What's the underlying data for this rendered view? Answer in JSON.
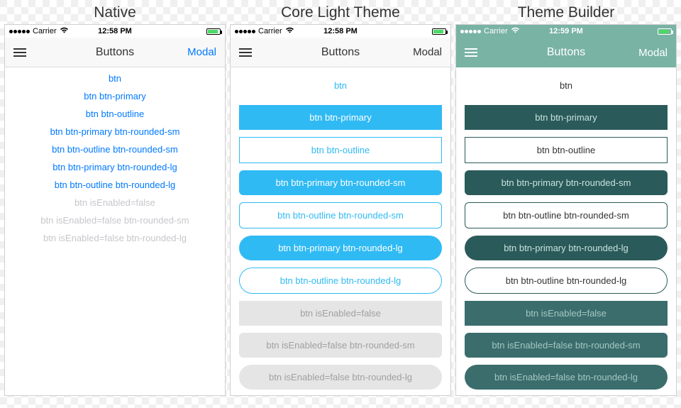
{
  "columns": {
    "native": {
      "title": "Native"
    },
    "light": {
      "title": "Core Light Theme"
    },
    "tb": {
      "title": "Theme Builder"
    }
  },
  "status": {
    "carrier": "Carrier",
    "wifi": "ᴡ",
    "time_a": "12:58 PM",
    "time_b": "12:59 PM"
  },
  "nav": {
    "title": "Buttons",
    "modal": "Modal"
  },
  "buttons": {
    "b1": "btn",
    "b2": "btn btn-primary",
    "b3": "btn btn-outline",
    "b4": "btn btn-primary btn-rounded-sm",
    "b5": "btn btn-outline btn-rounded-sm",
    "b6": "btn btn-primary btn-rounded-lg",
    "b7": "btn btn-outline btn-rounded-lg",
    "b8": "btn isEnabled=false",
    "b9": "btn isEnabled=false btn-rounded-sm",
    "b10": "btn isEnabled=false btn-rounded-lg"
  }
}
